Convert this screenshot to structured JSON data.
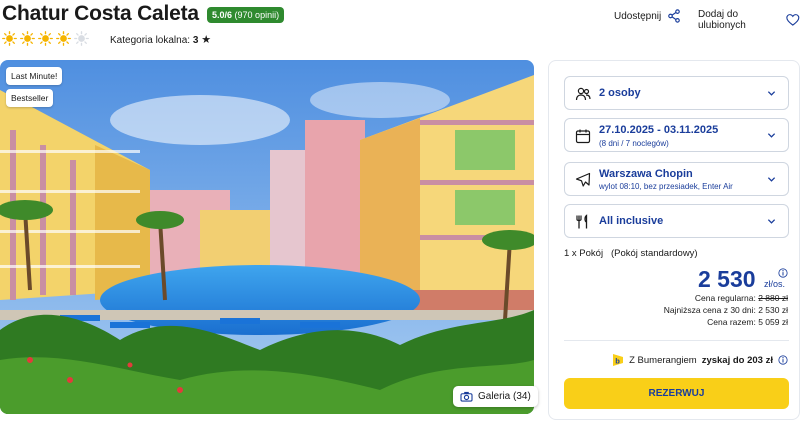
{
  "hotel": {
    "name": "Chatur Costa Caleta",
    "rating": "5.0/6",
    "rating_count": "(970 opinii)",
    "suns_filled": 4,
    "suns_total": 5,
    "category_label": "Kategoria lokalna:",
    "category_value": "3"
  },
  "actions": {
    "share_label": "Udostępnij",
    "favorite_label": "Dodaj do ulubionych"
  },
  "photo": {
    "badges": [
      "Last Minute!",
      "Bestseller"
    ],
    "gallery_label": "Galeria (34)"
  },
  "booking": {
    "guests": "2 osoby",
    "dates": "27.10.2025 - 03.11.2025",
    "duration": "(8 dni / 7 noclegów)",
    "airport": "Warszawa Chopin",
    "flight_info": "wylot 08:10, bez przesiadek, Enter Air",
    "board": "All inclusive",
    "room": "1 x Pokój   (Pokój standardowy)",
    "price": "2 530",
    "price_unit": "zł/os.",
    "regular_label": "Cena regularna:",
    "regular_value": "2 880 zł",
    "lowest_label": "Najniższa cena z 30 dni:",
    "lowest_value": "2 530 zł",
    "total_label": "Cena razem:",
    "total_value": "5 059 zł",
    "bumerang_prefix": "Z Bumerangiem",
    "bumerang_bold": "zyskaj do 203 zł",
    "book_label": "REZERWUJ"
  },
  "colors": {
    "accent": "#1a3d9b",
    "cta": "#f9cf18",
    "rating": "#2f8a2f",
    "sun": "#f5b400"
  }
}
